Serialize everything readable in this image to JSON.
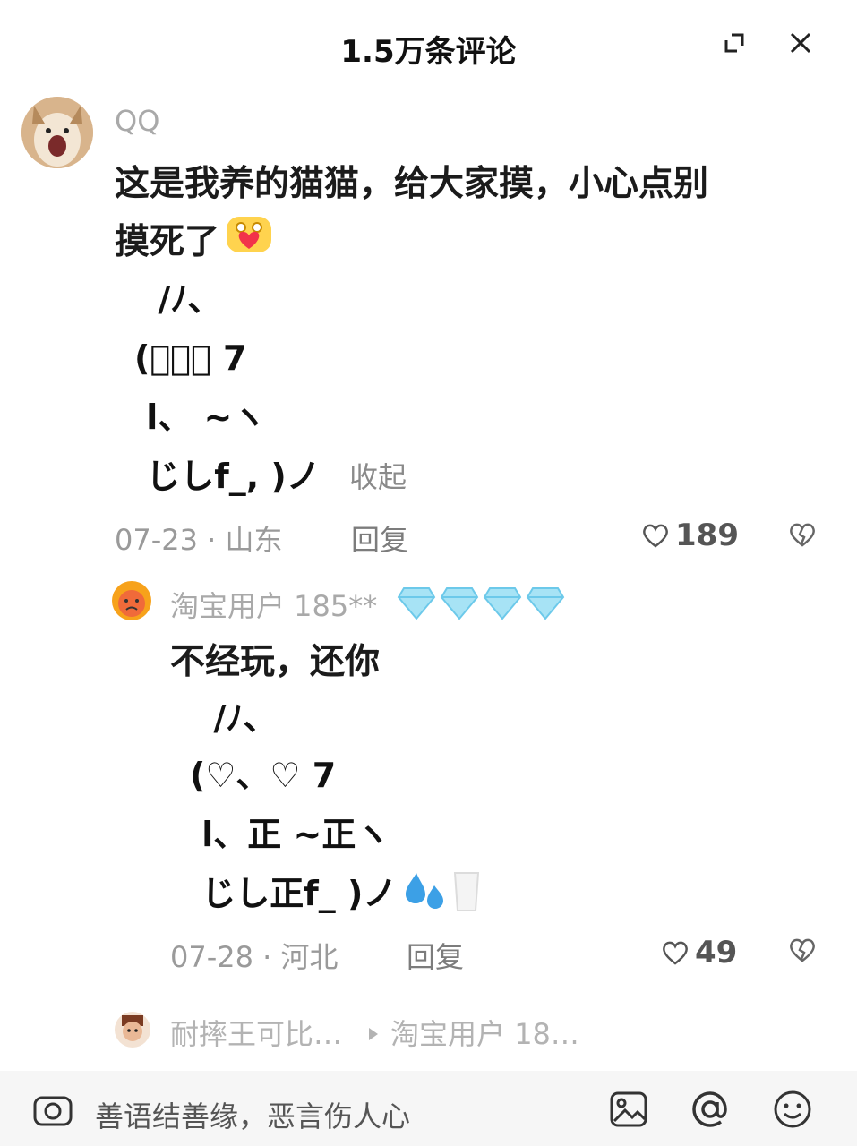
{
  "header": {
    "title": "1.5万条评论"
  },
  "comment1": {
    "user": "QQ",
    "text_line1": "这是我养的猫猫，给大家摸，小心点别",
    "text_line2": "摸死了",
    "ascii": [
      "  /ﾉ、",
      "(ﾟ、。 7",
      " l、 ~ヽ",
      " じしf_, )ノ"
    ],
    "collapse_label": "收起",
    "date_location": "07-23 · 山东",
    "reply_label": "回复",
    "likes": "189"
  },
  "reply1": {
    "user": "淘宝用户 185**",
    "text": "不经玩，还你",
    "ascii": [
      "  /ﾉ、",
      "(♡、♡ 7",
      " l、正 ~正ヽ",
      " じし正f_ )ノ"
    ],
    "date_location": "07-28 · 河北",
    "reply_label": "回复",
    "likes": "49"
  },
  "reply2_preview": {
    "user": "耐摔王可比…",
    "target": "淘宝用户 18…"
  },
  "input": {
    "placeholder": "善语结善缘，恶言伤人心"
  }
}
